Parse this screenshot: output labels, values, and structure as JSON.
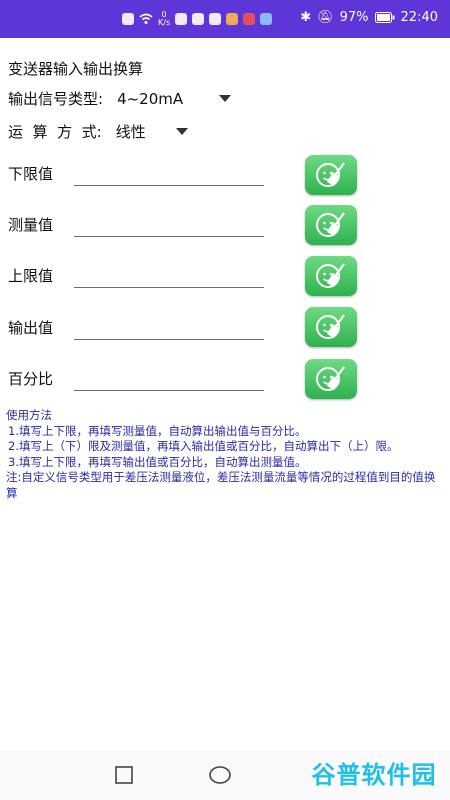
{
  "statusbar": {
    "speed_value": "0",
    "speed_unit": "K/s",
    "battery": "97%",
    "time": "22:40"
  },
  "app": {
    "title": "变送器输入输出换算"
  },
  "signal_type": {
    "label": "输出信号类型:",
    "value": "4~20mA"
  },
  "calc_mode": {
    "label": "运  算  方  式:",
    "value": "线性"
  },
  "fields": [
    {
      "label": "下限值",
      "value": ""
    },
    {
      "label": "测量值",
      "value": ""
    },
    {
      "label": "上限值",
      "value": ""
    },
    {
      "label": "输出值",
      "value": ""
    },
    {
      "label": "百分比",
      "value": ""
    }
  ],
  "help": {
    "heading": "使用方法",
    "lines": [
      "1.填写上下限，再填写测量值，自动算出输出值与百分比。",
      "2.填写上（下）限及测量值，再填入输出值或百分比，自动算出下（上）限。",
      "3.填写上下限，再填写输出值或百分比，自动算出测量值。",
      "注:自定义信号类型用于差压法测量液位，差压法测量流量等情况的过程值到目的值换算"
    ]
  },
  "watermark": "谷普软件园",
  "colors": {
    "status_bar": "#5e35d6",
    "help_text": "#2a2aa8",
    "clear_button": "#3dbf5a"
  }
}
